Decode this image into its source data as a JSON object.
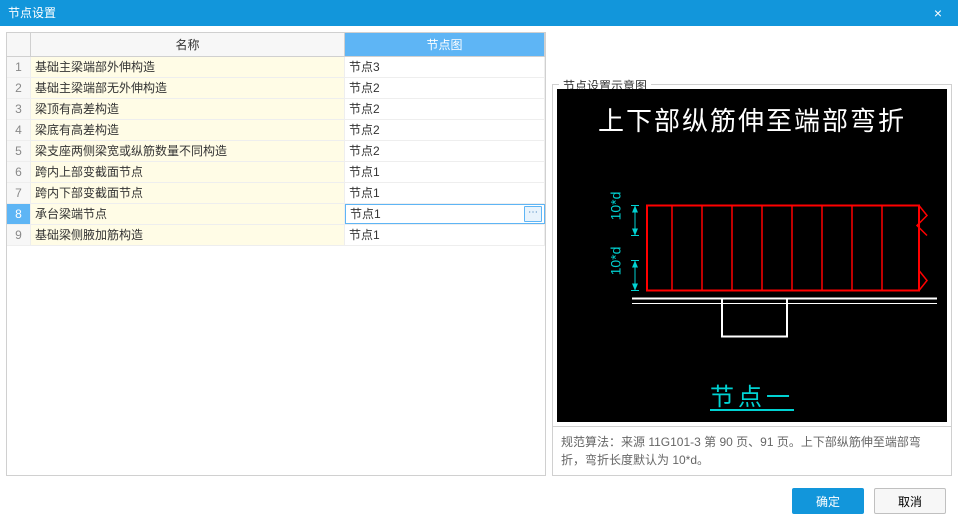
{
  "window": {
    "title": "节点设置"
  },
  "table": {
    "headers": {
      "name": "名称",
      "diagram": "节点图"
    },
    "rows": [
      {
        "num": "1",
        "name": "基础主梁端部外伸构造",
        "diagram": "节点3"
      },
      {
        "num": "2",
        "name": "基础主梁端部无外伸构造",
        "diagram": "节点2"
      },
      {
        "num": "3",
        "name": "梁顶有高差构造",
        "diagram": "节点2"
      },
      {
        "num": "4",
        "name": "梁底有高差构造",
        "diagram": "节点2"
      },
      {
        "num": "5",
        "name": "梁支座两侧梁宽或纵筋数量不同构造",
        "diagram": "节点2"
      },
      {
        "num": "6",
        "name": "跨内上部变截面节点",
        "diagram": "节点1"
      },
      {
        "num": "7",
        "name": "跨内下部变截面节点",
        "diagram": "节点1"
      },
      {
        "num": "8",
        "name": "承台梁端节点",
        "diagram": "节点1"
      },
      {
        "num": "9",
        "name": "基础梁侧腋加筋构造",
        "diagram": "节点1"
      }
    ],
    "selected_index": 7
  },
  "preview": {
    "legend": "节点设置示意图",
    "diagram_title": "上下部纵筋伸至端部弯折",
    "diagram_caption": "节点一",
    "dim1": "10*d",
    "dim2": "10*d",
    "description": "规范算法：来源 11G101-3 第 90 页、91 页。上下部纵筋伸至端部弯折，弯折长度默认为 10*d。"
  },
  "footer": {
    "ok": "确定",
    "cancel": "取消"
  }
}
